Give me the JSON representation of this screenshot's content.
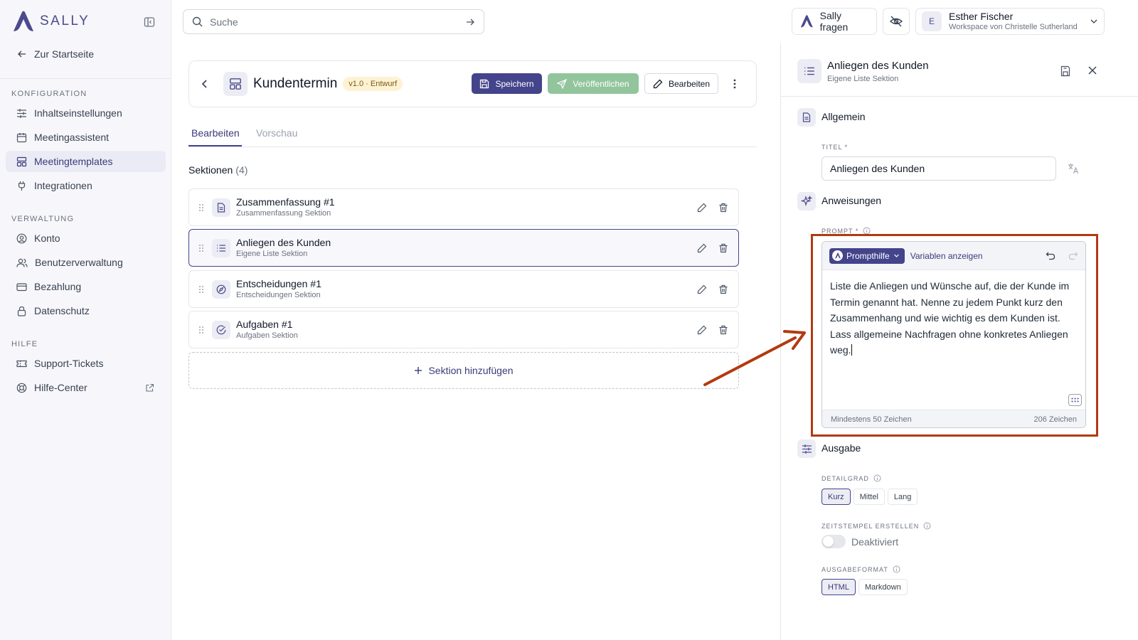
{
  "app": {
    "logo_text": "SALLY"
  },
  "sidebar": {
    "home_label": "Zur Startseite",
    "sections": [
      {
        "title": "KONFIGURATION",
        "items": [
          {
            "label": "Inhaltseinstellungen",
            "icon": "sliders-icon"
          },
          {
            "label": "Meetingassistent",
            "icon": "calendar-icon"
          },
          {
            "label": "Meetingtemplates",
            "icon": "layout-icon",
            "active": true
          },
          {
            "label": "Integrationen",
            "icon": "plug-icon"
          }
        ]
      },
      {
        "title": "VERWALTUNG",
        "items": [
          {
            "label": "Konto",
            "icon": "user-circle-icon"
          },
          {
            "label": "Benutzerverwaltung",
            "icon": "users-icon"
          },
          {
            "label": "Bezahlung",
            "icon": "credit-card-icon"
          },
          {
            "label": "Datenschutz",
            "icon": "lock-icon"
          }
        ]
      },
      {
        "title": "HILFE",
        "items": [
          {
            "label": "Support-Tickets",
            "icon": "ticket-icon"
          },
          {
            "label": "Hilfe-Center",
            "icon": "lifebuoy-icon"
          }
        ]
      }
    ]
  },
  "topbar": {
    "search_placeholder": "Suche",
    "ask_sally": "Sally fragen",
    "user_initial": "E",
    "user_name": "Esther Fischer",
    "workspace": "Workspace von Christelle Sutherland"
  },
  "template": {
    "title": "Kundentermin",
    "version_badge": "v1.0 · Entwurf",
    "save_label": "Speichern",
    "publish_label": "Veröffentlichen",
    "edit_label": "Bearbeiten"
  },
  "tabs": {
    "edit": "Bearbeiten",
    "preview": "Vorschau"
  },
  "sections_list": {
    "heading": "Sektionen",
    "count": "(4)",
    "items": [
      {
        "title": "Zusammenfassung #1",
        "subtitle": "Zusammenfassung Sektion"
      },
      {
        "title": "Anliegen des Kunden",
        "subtitle": "Eigene Liste Sektion"
      },
      {
        "title": "Entscheidungen #1",
        "subtitle": "Entscheidungen Sektion"
      },
      {
        "title": "Aufgaben #1",
        "subtitle": "Aufgaben Sektion"
      }
    ],
    "add_label": "Sektion hinzufügen"
  },
  "panel": {
    "title": "Anliegen des Kunden",
    "subtitle": "Eigene Liste Sektion",
    "general_heading": "Allgemein",
    "title_label": "TITEL *",
    "title_value": "Anliegen des Kunden",
    "instructions_heading": "Anweisungen",
    "prompt_label": "PROMPT *",
    "prompt_help": "Prompthilfe",
    "show_variables": "Variablen anzeigen",
    "prompt_text": "Liste die Anliegen und Wünsche auf, die der Kunde im Termin genannt hat. Nenne zu jedem Punkt kurz den Zusammenhang und wie wichtig es dem Kunden ist. Lass allgemeine Nachfragen ohne konkretes Anliegen weg.",
    "min_chars": "Mindestens 50 Zeichen",
    "char_count": "206 Zeichen",
    "output_heading": "Ausgabe",
    "detail_label": "DETAILGRAD",
    "detail_options": [
      "Kurz",
      "Mittel",
      "Lang"
    ],
    "timestamp_label": "ZEITSTEMPEL ERSTELLEN",
    "timestamp_value": "Deaktiviert",
    "format_label": "AUSGABEFORMAT",
    "format_options": [
      "HTML",
      "Markdown"
    ]
  },
  "colors": {
    "accent": "#44448c",
    "publish": "#93c59d",
    "highlight": "#b23a10"
  }
}
